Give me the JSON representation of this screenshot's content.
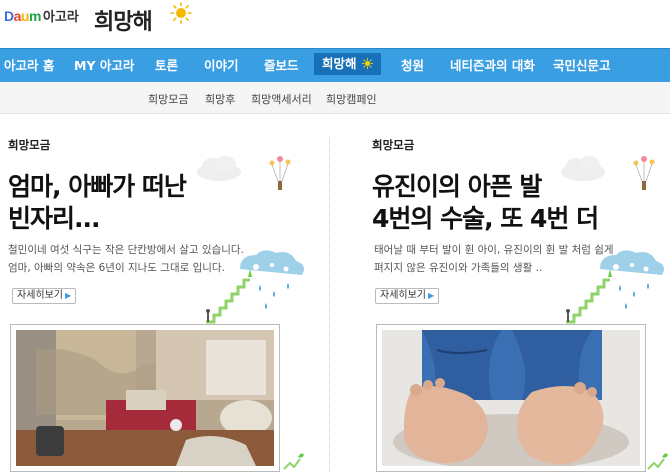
{
  "brand": {
    "daum_letters": [
      "D",
      "a",
      "u",
      "m"
    ],
    "agora": "아고라",
    "hope": "희망해"
  },
  "nav": {
    "items": [
      {
        "label": "아고라 홈"
      },
      {
        "label": "MY 아고라"
      },
      {
        "label": "토론"
      },
      {
        "label": "이야기"
      },
      {
        "label": "즐보드"
      },
      {
        "label": "희망해",
        "active": true
      },
      {
        "label": "청원"
      },
      {
        "label": "네티즌과의 대화"
      },
      {
        "label": "국민신문고"
      }
    ]
  },
  "subnav": {
    "items": [
      "희망모금",
      "희망후",
      "희망액세서리",
      "희망캠페인"
    ]
  },
  "stories": [
    {
      "label": "희망모금",
      "title_line1": "엄마, 아빠가 떠난",
      "title_line2": "빈자리...",
      "desc_line1": "철민이네 여섯 식구는 작은 단칸방에서 살고 있습니다.",
      "desc_line2": "엄마, 아빠의 약속은 6년이 지나도 그대로 입니다.",
      "more": "자세히보기"
    },
    {
      "label": "희망모금",
      "title_line1": "유진이의 아픈 발",
      "title_line2": "4번의 수술, 또 4번 더",
      "desc_line1": "태어날 때 부터 발이 휜 아이, 유진이의 휜 발 처럼 쉽게",
      "desc_line2": "펴지지 않은 유진이와 가족들의 생활 ..",
      "more": "자세히보기"
    }
  ],
  "colors": {
    "nav_bg": "#3a9ee3",
    "nav_active": "#1870b8",
    "sun": "#f5b800"
  }
}
